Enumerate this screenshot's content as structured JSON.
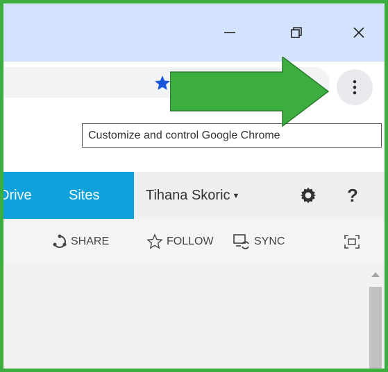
{
  "browser": {
    "menu_tooltip": "Customize and control Google Chrome",
    "icons": [
      "minimize-icon",
      "restore-icon",
      "close-icon",
      "star-icon",
      "three-dot-menu-icon"
    ],
    "colors": {
      "titlebar": "#d3e3fd",
      "star": "#1a56db",
      "annotation_arrow": "#3cae3f",
      "frame_border": "#3cae3f"
    }
  },
  "suitebar": {
    "onedrive_label": "Drive",
    "sites_label": "Sites",
    "user_name": "Tihana Skoric",
    "help_label": "?",
    "colors": {
      "active_link_bg": "#0ea1dc",
      "bar_bg": "#efefef"
    }
  },
  "actions": {
    "share": "SHARE",
    "follow": "FOLLOW",
    "sync": "SYNC"
  }
}
